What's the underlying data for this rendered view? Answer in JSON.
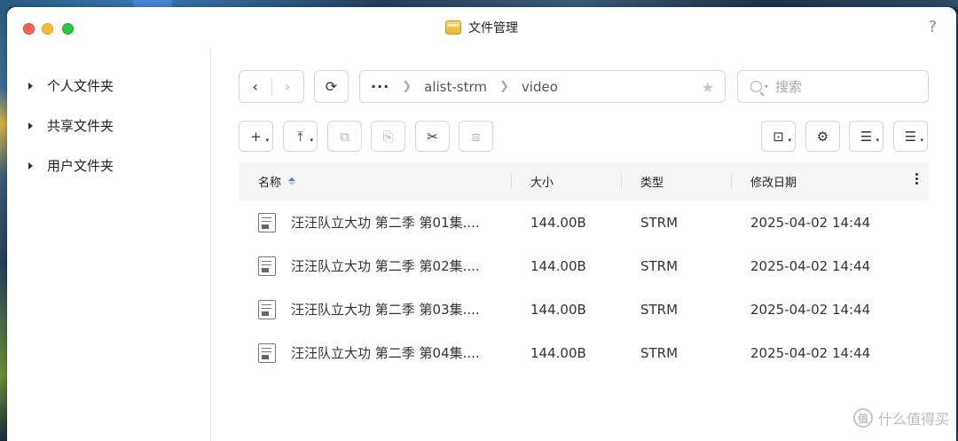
{
  "window": {
    "title": "文件管理",
    "help": "?"
  },
  "sidebar": {
    "items": [
      {
        "label": "个人文件夹"
      },
      {
        "label": "共享文件夹"
      },
      {
        "label": "用户文件夹"
      }
    ]
  },
  "toolbar": {
    "back": "‹",
    "forward": "›",
    "refresh": "⟳",
    "path": {
      "more": "···",
      "segments": [
        "alist-strm",
        "video"
      ]
    },
    "search_placeholder": "搜索",
    "tools": {
      "new": "+",
      "upload": "⤒",
      "copy": "⧉",
      "move": "⎘",
      "cut": "✂",
      "compress": "⧈",
      "task": "⊡",
      "settings": "⚙",
      "view": "☰",
      "sort": "☰"
    }
  },
  "table": {
    "columns": {
      "name": "名称",
      "size": "大小",
      "type": "类型",
      "modified": "修改日期"
    },
    "rows": [
      {
        "name": "汪汪队立大功 第二季 第01集....",
        "size": "144.00B",
        "type": "STRM",
        "modified": "2025-04-02 14:44"
      },
      {
        "name": "汪汪队立大功 第二季 第02集....",
        "size": "144.00B",
        "type": "STRM",
        "modified": "2025-04-02 14:44"
      },
      {
        "name": "汪汪队立大功 第二季 第03集....",
        "size": "144.00B",
        "type": "STRM",
        "modified": "2025-04-02 14:44"
      },
      {
        "name": "汪汪队立大功 第二季 第04集....",
        "size": "144.00B",
        "type": "STRM",
        "modified": "2025-04-02 14:44"
      }
    ]
  },
  "watermark": {
    "badge": "值",
    "text": "什么值得买"
  },
  "colors": {
    "accent": "#3b7ddd",
    "close": "#fe5f57",
    "minimize": "#febc2e",
    "maximize": "#28c840"
  }
}
